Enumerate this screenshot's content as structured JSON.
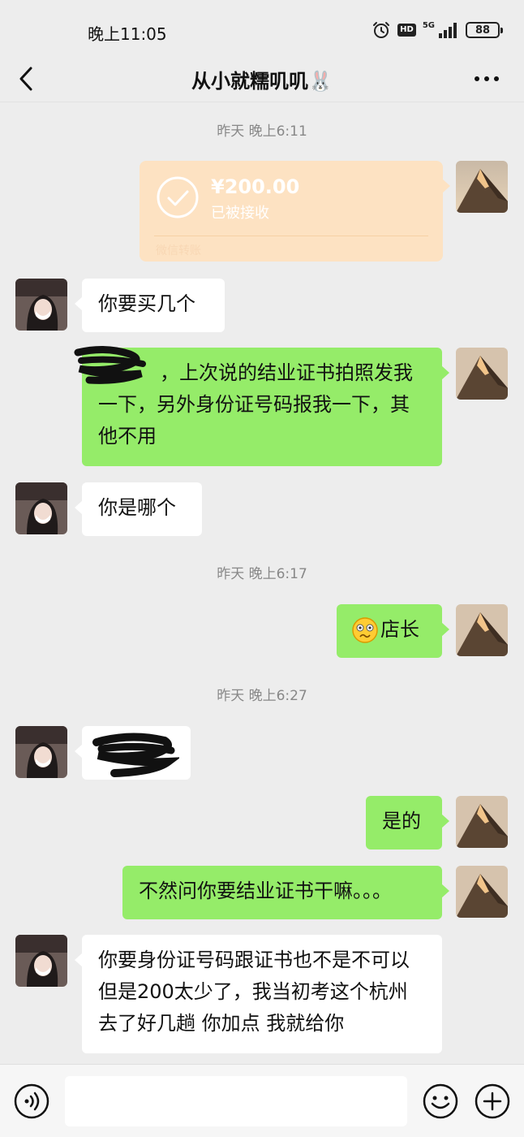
{
  "status_bar": {
    "time": "晚上11:05",
    "network": "5G",
    "hd": "HD",
    "battery": "88",
    "icons": [
      "alarm-icon",
      "hd-icon",
      "signal-icon",
      "battery-icon"
    ]
  },
  "nav": {
    "title": "从小就糯叽叽🐰",
    "back_icon": "chevron-left-icon",
    "more_icon": "more-icon"
  },
  "chat": {
    "timestamps": [
      "昨天 晚上6:11",
      "昨天 晚上6:17",
      "昨天 晚上6:27"
    ],
    "transfer": {
      "amount": "¥200.00",
      "status": "已被接收",
      "footer": "微信转账"
    },
    "messages": [
      {
        "side": "left",
        "text": "你要买几个"
      },
      {
        "side": "right",
        "text": "，上次说的结业证书拍照发我一下，另外身份证号码报我一下，其他不用",
        "redacted_prefix": true
      },
      {
        "side": "left",
        "text": "你是哪个"
      },
      {
        "side": "right",
        "text": "店长",
        "emoji": "dizzy-face-emoji"
      },
      {
        "side": "left",
        "text": "",
        "redacted": true
      },
      {
        "side": "right",
        "text": "是的"
      },
      {
        "side": "right",
        "text": "不然问你要结业证书干嘛。。。"
      },
      {
        "side": "left",
        "text": "你要身份证号码跟证书也不是不可以但是200太少了，我当初考这个杭州去了好几趟 你加点 我就给你"
      }
    ]
  },
  "input_bar": {
    "placeholder": "",
    "voice_icon": "voice-icon",
    "emoji_icon": "smile-icon",
    "plus_icon": "plus-icon"
  },
  "colors": {
    "background": "#ededed",
    "sent_bubble": "#95ec69",
    "received_bubble": "#ffffff",
    "transfer_accepted": "#fde2c2"
  }
}
